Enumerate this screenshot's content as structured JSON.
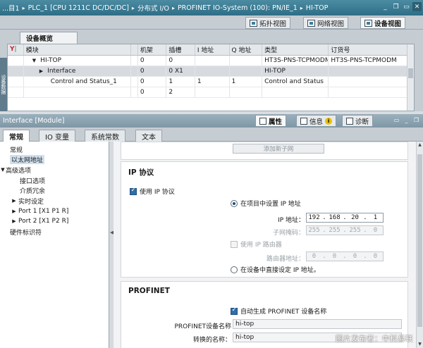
{
  "titlebar": {
    "crumbs": [
      "...目1",
      "PLC_1 [CPU 1211C DC/DC/DC]",
      "分布式 I/O",
      "PROFINET IO-System (100): PN/IE_1",
      "HI-TOP"
    ],
    "separator": "▸"
  },
  "views": {
    "topology": "拓扑视图",
    "network": "网络视图",
    "device": "设备视图"
  },
  "device_overview": {
    "tab": "设备概览",
    "side_label": "设备数据",
    "columns": [
      "",
      "模块",
      "",
      "机架",
      "插槽",
      "I 地址",
      "Q 地址",
      "类型",
      "订货号"
    ],
    "rows": [
      {
        "module": "HI-TOP",
        "rack": "0",
        "slot": "0",
        "iaddr": "",
        "qaddr": "",
        "type": "HT3S-PNS-TCPMODM",
        "order": "HT3S-PNS-TCPMODM"
      },
      {
        "module": "Interface",
        "rack": "0",
        "slot": "0 X1",
        "iaddr": "",
        "qaddr": "",
        "type": "HI-TOP",
        "order": ""
      },
      {
        "module": "Control and Status_1",
        "rack": "0",
        "slot": "1",
        "iaddr": "1",
        "qaddr": "1",
        "type": "Control and Status",
        "order": ""
      },
      {
        "module": "",
        "rack": "0",
        "slot": "2",
        "iaddr": "",
        "qaddr": "",
        "type": "",
        "order": ""
      }
    ]
  },
  "inspector": {
    "title": "Interface [Module]",
    "properties": "属性",
    "info": "信息",
    "info_badge": "i",
    "diagnostics": "诊断"
  },
  "prop_tabs": {
    "general": "常规",
    "io_vars": "IO 变量",
    "sys_constants": "系统常数",
    "texts": "文本"
  },
  "tree": {
    "items": [
      {
        "label": "常规",
        "indent": 0,
        "arrow": ""
      },
      {
        "label": "以太网地址",
        "indent": 0,
        "arrow": ""
      },
      {
        "label": "高级选项",
        "indent": 0,
        "arrow": "▼"
      },
      {
        "label": "接口选项",
        "indent": 1,
        "arrow": ""
      },
      {
        "label": "介质冗余",
        "indent": 1,
        "arrow": ""
      },
      {
        "label": "实时设定",
        "indent": 1,
        "arrow": "▶"
      },
      {
        "label": "Port 1 [X1 P1 R]",
        "indent": 1,
        "arrow": "▶"
      },
      {
        "label": "Port 2 [X1 P2 R]",
        "indent": 1,
        "arrow": "▶"
      },
      {
        "label": "硬件标识符",
        "indent": 0,
        "arrow": ""
      }
    ]
  },
  "content": {
    "add_subnet": "添加新子网",
    "ip_section": "IP 协议",
    "use_ip": "使用 IP 协议",
    "set_in_project": "在项目中设置 IP 地址",
    "ip_label": "IP 地址：",
    "ip": [
      "192",
      "168",
      "20",
      "1"
    ],
    "mask_label": "子网掩码：",
    "mask": [
      "255",
      "255",
      "255",
      "0"
    ],
    "use_router": "使用 IP 路由器",
    "router_label": "路由器地址：",
    "router": [
      "0",
      "0",
      "0",
      "0"
    ],
    "set_on_device": "在设备中直接设定 IP 地址。",
    "profinet_section": "PROFINET",
    "auto_name": "自动生成 PROFINET 设备名称",
    "device_name_label": "PROFINET设备名称",
    "device_name": "hi-top",
    "converted_label": "转换的名称：",
    "converted_name": "hi-top"
  },
  "watermark": "图片发布者：中科易联"
}
